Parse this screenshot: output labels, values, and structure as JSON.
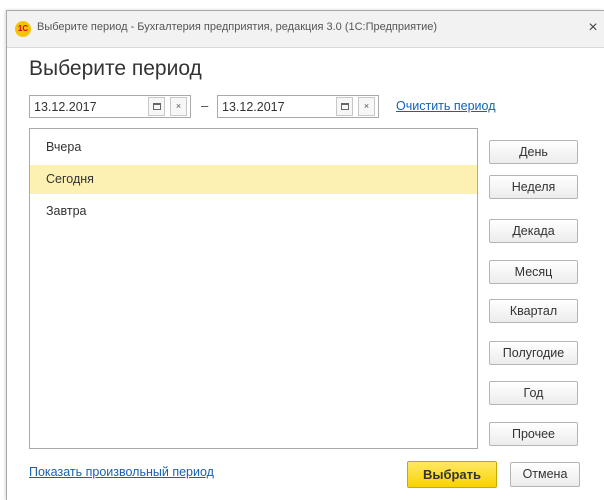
{
  "window": {
    "title": "Выберите период - Бухгалтерия предприятия, редакция 3.0  (1С:Предприятие)",
    "logo_text": "1С",
    "close_glyph": "×"
  },
  "heading": "Выберите период",
  "period": {
    "start_date": "13.12.2017",
    "end_date": "13.12.2017",
    "dash": "–",
    "clear_glyph": "×",
    "clear_link": "Очистить период"
  },
  "list": {
    "items": [
      "Вчера",
      "Сегодня",
      "Завтра"
    ],
    "selected_index": 1,
    "selected_color": "#fcf0b2"
  },
  "side_buttons": [
    "День",
    "Неделя",
    "Декада",
    "Месяц",
    "Квартал",
    "Полугодие",
    "Год",
    "Прочее"
  ],
  "footer": {
    "custom_period_link": "Показать произвольный период",
    "select_button": "Выбрать",
    "cancel_button": "Отмена"
  },
  "colors": {
    "accent": "#f8d300",
    "link": "#1a5fb4"
  },
  "icons": {
    "calendar": "calendar-icon",
    "clear": "clear-icon",
    "close": "close-icon",
    "logo": "1c-logo-icon"
  }
}
